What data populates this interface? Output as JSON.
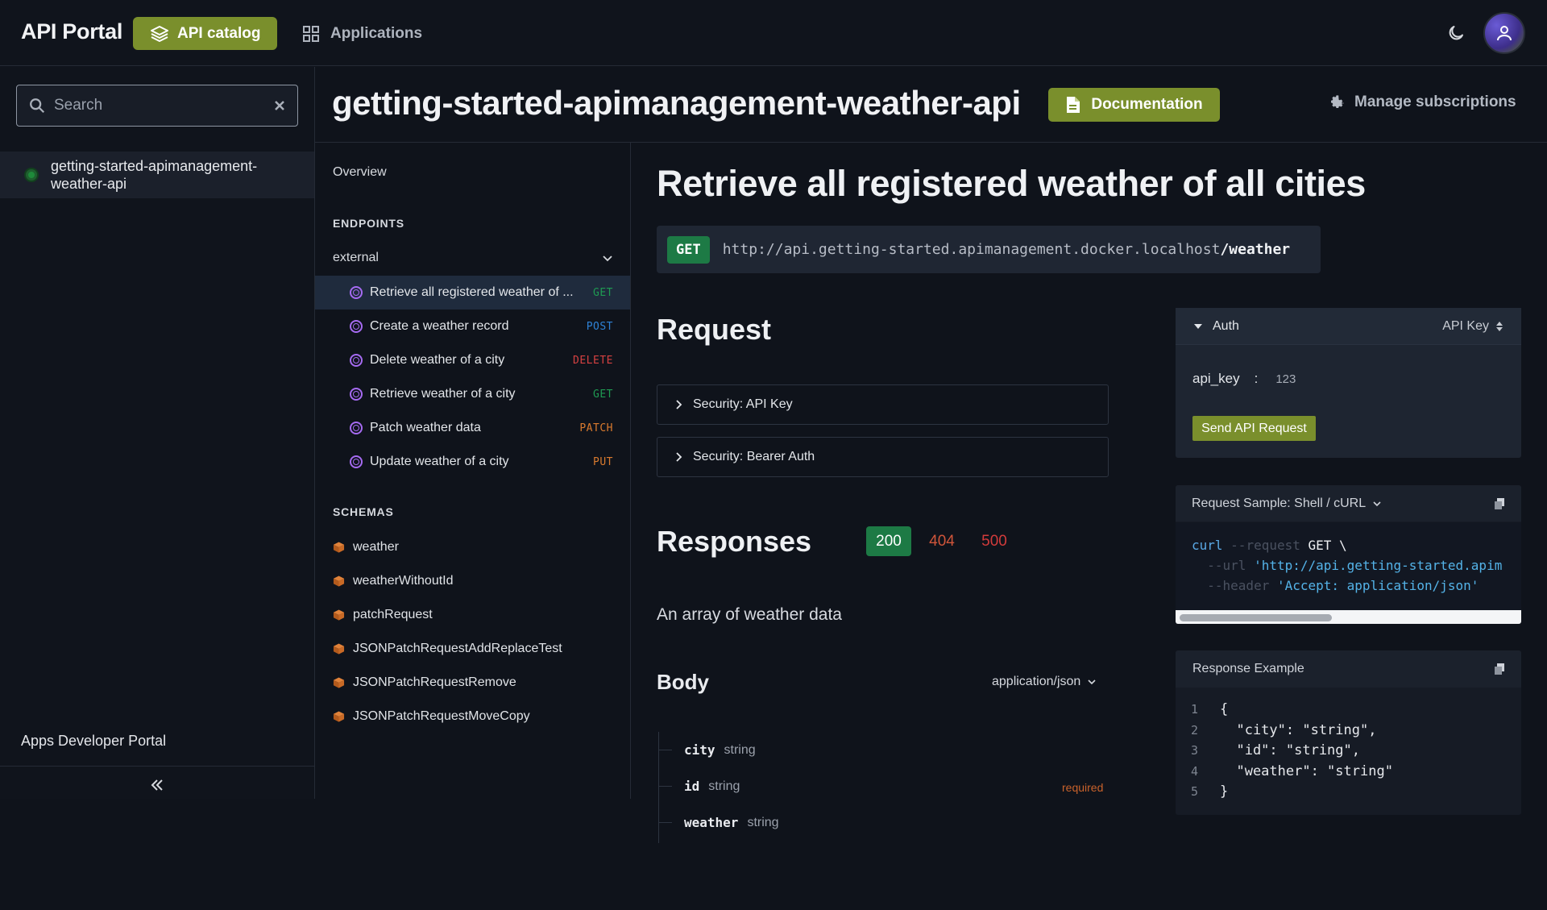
{
  "topbar": {
    "brand": "API Portal",
    "nav_catalog": "API catalog",
    "nav_applications": "Applications"
  },
  "sidebar": {
    "search_placeholder": "Search",
    "api_item": "getting-started-apimanagement-weather-api",
    "footer": "Apps Developer Portal"
  },
  "header": {
    "api_title": "getting-started-apimanagement-weather-api",
    "documentation_label": "Documentation",
    "manage_subscriptions_label": "Manage subscriptions"
  },
  "nav": {
    "overview": "Overview",
    "endpoints_heading": "ENDPOINTS",
    "group": "external",
    "endpoints": [
      {
        "label": "Retrieve all registered weather of ...",
        "method": "GET"
      },
      {
        "label": "Create a weather record",
        "method": "POST"
      },
      {
        "label": "Delete weather of a city",
        "method": "DELETE"
      },
      {
        "label": "Retrieve weather of a city",
        "method": "GET"
      },
      {
        "label": "Patch weather data",
        "method": "PATCH"
      },
      {
        "label": "Update weather of a city",
        "method": "PUT"
      }
    ],
    "schemas_heading": "SCHEMAS",
    "schemas": [
      "weather",
      "weatherWithoutId",
      "patchRequest",
      "JSONPatchRequestAddReplaceTest",
      "JSONPatchRequestRemove",
      "JSONPatchRequestMoveCopy"
    ]
  },
  "operation": {
    "title": "Retrieve all registered weather of all cities",
    "method": "GET",
    "url_base": "http://api.getting-started.apimanagement.docker.localhost",
    "url_path": "/weather",
    "request_heading": "Request",
    "security_items": [
      "Security: API Key",
      "Security: Bearer Auth"
    ],
    "responses_heading": "Responses",
    "response_codes": [
      "200",
      "404",
      "500"
    ],
    "response_description": "An array of weather data",
    "body_heading": "Body",
    "content_type": "application/json",
    "properties": [
      {
        "name": "city",
        "type": "string",
        "required": ""
      },
      {
        "name": "id",
        "type": "string",
        "required": "required"
      },
      {
        "name": "weather",
        "type": "string",
        "required": ""
      }
    ]
  },
  "auth": {
    "heading": "Auth",
    "scheme": "API Key",
    "field_name": "api_key",
    "separator": ":",
    "field_value": "123",
    "send_label": "Send API Request"
  },
  "request_sample": {
    "heading": "Request Sample: Shell / cURL",
    "line1_cmd": "curl",
    "line1_flag": "--request",
    "line1_val": "GET \\",
    "line2_flag": "--url",
    "line2_val": "'http://api.getting-started.apim",
    "line3_flag": "--header",
    "line3_val": "'Accept: application/json'"
  },
  "response_example": {
    "heading": "Response Example",
    "lines": [
      {
        "n": "1",
        "t": "{"
      },
      {
        "n": "2",
        "t": "  \"city\": \"string\","
      },
      {
        "n": "3",
        "t": "  \"id\": \"string\","
      },
      {
        "n": "4",
        "t": "  \"weather\": \"string\""
      },
      {
        "n": "5",
        "t": "}"
      }
    ]
  }
}
